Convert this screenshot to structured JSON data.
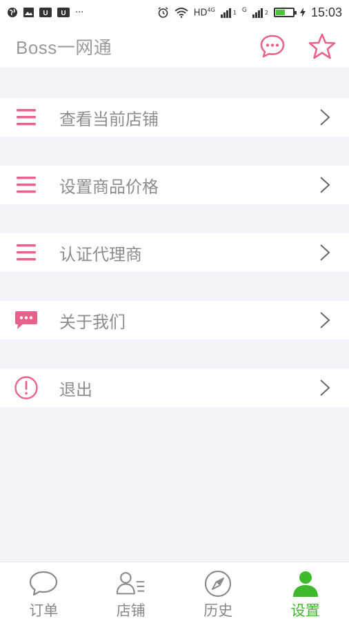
{
  "status_bar": {
    "time": "15:03",
    "hd_label": "HD",
    "network_4g": "4G",
    "network_g": "G",
    "sim1": "1",
    "sim2": "2",
    "ellipsis": "···",
    "icons": [
      "globe-icon",
      "image-icon",
      "u-app-icon",
      "u-app-icon",
      "alarm-icon",
      "wifi-icon",
      "signal-icon",
      "signal-icon",
      "battery-icon",
      "charging-icon"
    ],
    "battery_level": 0.55
  },
  "header": {
    "title": "Boss一网通",
    "actions": [
      "chat-icon",
      "star-icon"
    ]
  },
  "menu": [
    {
      "label": "查看当前店铺",
      "icon": "list-icon"
    },
    {
      "label": "设置商品价格",
      "icon": "list-icon"
    },
    {
      "label": "认证代理商",
      "icon": "list-icon"
    },
    {
      "label": "关于我们",
      "icon": "message-icon"
    },
    {
      "label": "退出",
      "icon": "alert-icon"
    }
  ],
  "bottom_nav": [
    {
      "label": "订单",
      "icon": "chat-bubble-icon",
      "active": false
    },
    {
      "label": "店铺",
      "icon": "user-list-icon",
      "active": false
    },
    {
      "label": "历史",
      "icon": "compass-icon",
      "active": false
    },
    {
      "label": "设置",
      "icon": "person-icon",
      "active": true
    }
  ],
  "colors": {
    "accent_pink": "#e8628b",
    "active_green": "#3db92b",
    "background": "#f3f4f9"
  }
}
